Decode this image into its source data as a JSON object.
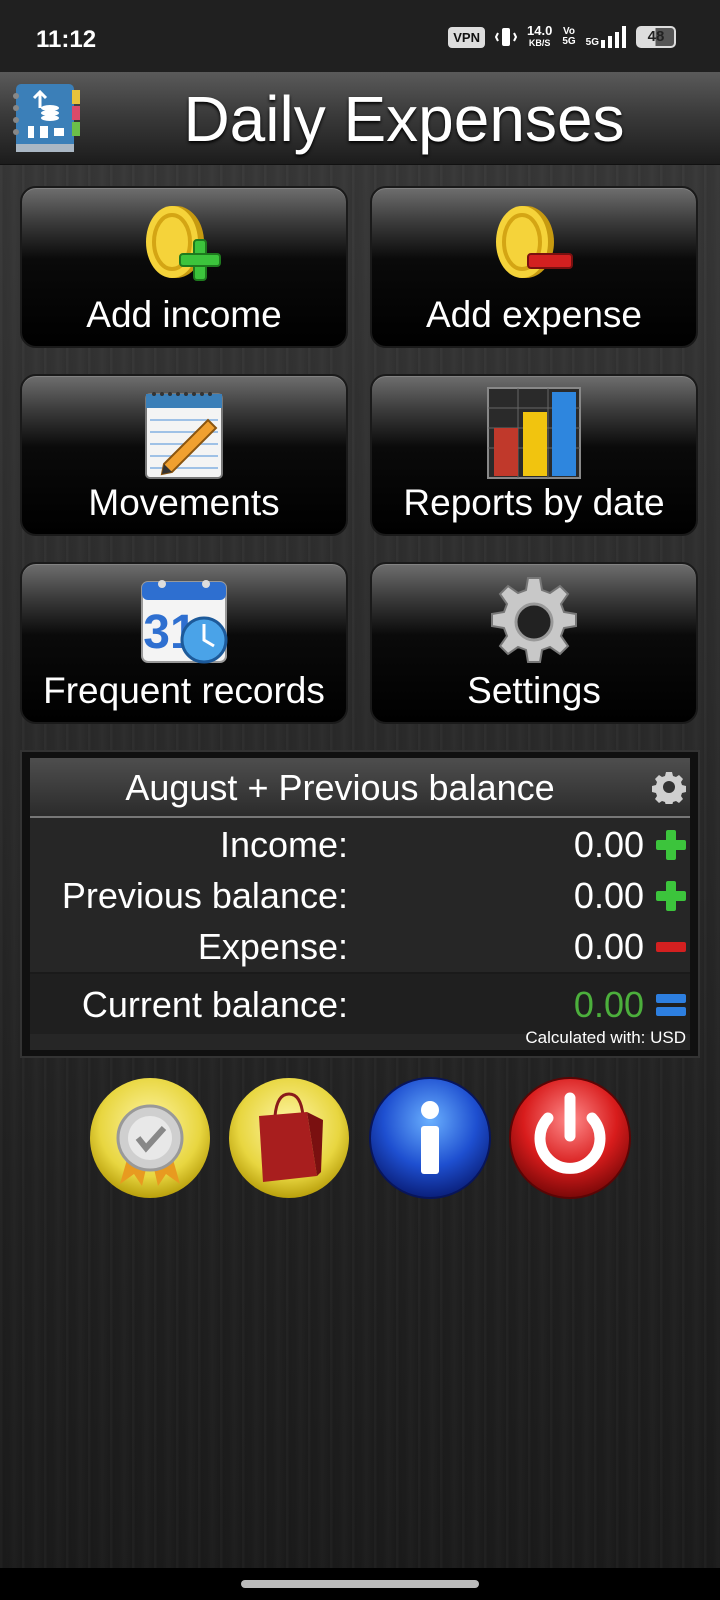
{
  "status_bar": {
    "time": "11:12",
    "vpn": "VPN",
    "speed_value": "14.0",
    "speed_unit": "KB/S",
    "volte_top": "Vo",
    "volte_bottom": "5G",
    "network": "5G",
    "battery": "48"
  },
  "header": {
    "title": "Daily Expenses",
    "logo_icon": "expense-book-icon"
  },
  "menu": [
    {
      "label": "Add income",
      "icon": "coin-plus-icon"
    },
    {
      "label": "Add expense",
      "icon": "coin-minus-icon"
    },
    {
      "label": "Movements",
      "icon": "notepad-pencil-icon"
    },
    {
      "label": "Reports by date",
      "icon": "bar-chart-icon"
    },
    {
      "label": "Frequent records",
      "icon": "calendar-clock-icon",
      "calendar_day": "31"
    },
    {
      "label": "Settings",
      "icon": "gear-icon"
    }
  ],
  "balance": {
    "title": "August + Previous balance",
    "rows": [
      {
        "label": "Income:",
        "value": "0.00",
        "sign": "plus"
      },
      {
        "label": "Previous balance:",
        "value": "0.00",
        "sign": "plus"
      },
      {
        "label": "Expense:",
        "value": "0.00",
        "sign": "minus"
      },
      {
        "label": "Current balance:",
        "value": "0.00",
        "sign": "equals"
      }
    ],
    "note": "Calculated with: USD"
  },
  "bottom_buttons": [
    {
      "icon": "premium-badge-icon"
    },
    {
      "icon": "shopping-bag-icon"
    },
    {
      "icon": "info-icon"
    },
    {
      "icon": "power-icon"
    }
  ],
  "colors": {
    "current_balance": "#4caf3c",
    "plus": "#3cc43c",
    "minus": "#d32020",
    "equals": "#2d7fe0"
  }
}
